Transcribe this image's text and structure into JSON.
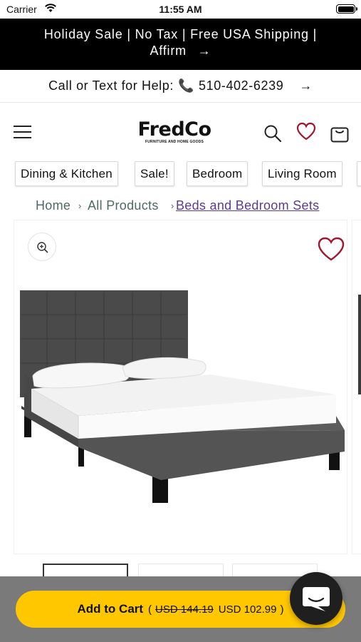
{
  "status_bar": {
    "carrier": "Carrier",
    "time": "11:55 AM"
  },
  "announcement": {
    "text": "Holiday Sale | No Tax | Free USA Shipping | Affirm",
    "arrow": "→"
  },
  "help_bar": {
    "label": "Call or Text for Help:",
    "phone_icon": "📞",
    "phone": "510-402-6239",
    "arrow": "→"
  },
  "header": {
    "logo_text": "FredCo",
    "logo_tagline": "FURNITURE AND HOME GOODS",
    "icons": [
      "menu-icon",
      "search-icon",
      "heart-icon",
      "bag-icon"
    ]
  },
  "categories": [
    {
      "label": "Dining & Kitchen"
    },
    {
      "label": "Sale!"
    },
    {
      "label": "Bedroom"
    },
    {
      "label": "Living Room"
    }
  ],
  "breadcrumb": {
    "items": [
      "Home",
      "All Products",
      "Beds and Bedroom Sets"
    ],
    "separator": "›"
  },
  "product": {
    "wishlist_icon": "heart-outline-icon",
    "zoom_icon": "zoom-in-icon"
  },
  "cart": {
    "label": "Add to Cart",
    "open_paren": "(",
    "old_price": "USD 144.19",
    "new_price": "USD 102.99",
    "close_paren": ")"
  },
  "colors": {
    "announcement_bg": "#000000",
    "accent_heart": "#a3142f",
    "breadcrumb_link": "#4f6b5f",
    "breadcrumb_current": "#5b3a96",
    "cart_button": "#ffc700",
    "bottom_overlay": "#7a7a7a",
    "chat_button": "#1f1f1f"
  }
}
